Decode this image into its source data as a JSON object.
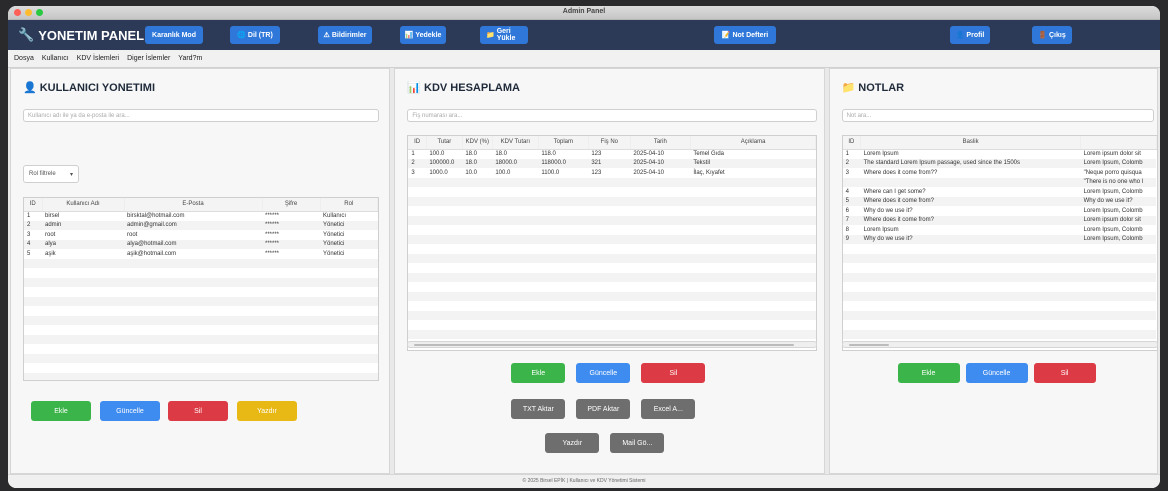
{
  "window": {
    "title": "Admin Panel"
  },
  "header": {
    "brand": "YONETIM PANELI",
    "buttons": {
      "dark_mode": "Karanlık Mod",
      "language": "Dil (TR)",
      "notifications": "Bildirimler",
      "backup": "Yedekle",
      "restore": "Geri Yükle",
      "notepad": "Not Defteri",
      "profile": "Profil",
      "logout": "Çıkış"
    }
  },
  "menu": [
    "Dosya",
    "Kullanıcı",
    "KDV İslemleri",
    "Diger İslemler",
    "Yard?m"
  ],
  "users_panel": {
    "title": "KULLANICI YONETIMI",
    "search_placeholder": "Kullanıcı adı ile ya da e-posta ile ara...",
    "role_filter": "Rol filtrele",
    "columns": [
      "ID",
      "Kullanıcı Adı",
      "E-Posta",
      "Şifre",
      "Rol"
    ],
    "rows": [
      [
        "1",
        "birsel",
        "birsktal@hotmail.com",
        "******",
        "Kullanıcı"
      ],
      [
        "2",
        "admin",
        "admin@gmail.com",
        "******",
        "Yönetici"
      ],
      [
        "3",
        "root",
        "root",
        "******",
        "Yönetici"
      ],
      [
        "4",
        "alya",
        "alya@hotmail.com",
        "******",
        "Yönetici"
      ],
      [
        "5",
        "aşik",
        "aşik@hotmail.com",
        "******",
        "Yönetici"
      ]
    ],
    "buttons": {
      "add": "Ekle",
      "update": "Güncelle",
      "delete": "Sil",
      "print": "Yazdır"
    }
  },
  "kdv_panel": {
    "title": "KDV HESAPLAMA",
    "search_placeholder": "Fiş numarası ara...",
    "columns": [
      "ID",
      "Tutar",
      "KDV (%)",
      "KDV Tutarı",
      "Toplam",
      "Fiş No",
      "Tarih",
      "Açıklama"
    ],
    "rows": [
      [
        "1",
        "100.0",
        "18.0",
        "18.0",
        "118.0",
        "123",
        "2025-04-10",
        "Temel Gıda"
      ],
      [
        "2",
        "100000.0",
        "18.0",
        "18000.0",
        "118000.0",
        "321",
        "2025-04-10",
        "Tekstil"
      ],
      [
        "3",
        "1000.0",
        "10.0",
        "100.0",
        "1100.0",
        "123",
        "2025-04-10",
        "İlaç, Kıyafet"
      ]
    ],
    "buttons": {
      "add": "Ekle",
      "update": "Güncelle",
      "delete": "Sil",
      "txt": "TXT Aktar",
      "pdf": "PDF Aktar",
      "excel": "Excel A...",
      "print": "Yazdır",
      "mail": "Mail Gö..."
    }
  },
  "notes_panel": {
    "title": "NOTLAR",
    "search_placeholder": "Not ara...",
    "columns": [
      "ID",
      "Baslik",
      ""
    ],
    "rows": [
      [
        "1",
        "Lorem Ipsum",
        "Lorem ipsum dolor sit"
      ],
      [
        "2",
        "The standard Lorem Ipsum passage, used since the 1500s",
        "Lorem Ipsum, Colomb"
      ],
      [
        "3",
        "Where does it come from??",
        "\"Neque porro quisqua"
      ],
      [
        "",
        "",
        "\"There is no one who l"
      ],
      [
        "4",
        "Where can I get some?",
        "Lorem Ipsum, Colomb"
      ],
      [
        "5",
        "Where does it come from?",
        "Why do we use it?"
      ],
      [
        "6",
        "Why do we use it?",
        "Lorem Ipsum, Colomb"
      ],
      [
        "7",
        "Where does it come from?",
        "Lorem ipsum dolor sit"
      ],
      [
        "8",
        "Lorem Ipsum",
        "Lorem Ipsum, Colomb"
      ],
      [
        "9",
        "Why do we use it?",
        "Lorem Ipsum, Colomb"
      ]
    ],
    "buttons": {
      "add": "Ekle",
      "update": "Güncelle",
      "delete": "Sil"
    }
  },
  "footer": "© 2025 Birsel EPİK | Kullanıcı ve KDV Yönetimi Sistemi",
  "colors": {
    "header": "#2d3a57",
    "blue": "#2f78d9",
    "green": "#3bb54a",
    "red": "#dc3a44",
    "yellow": "#e8b814",
    "gray": "#6e6e6e"
  }
}
